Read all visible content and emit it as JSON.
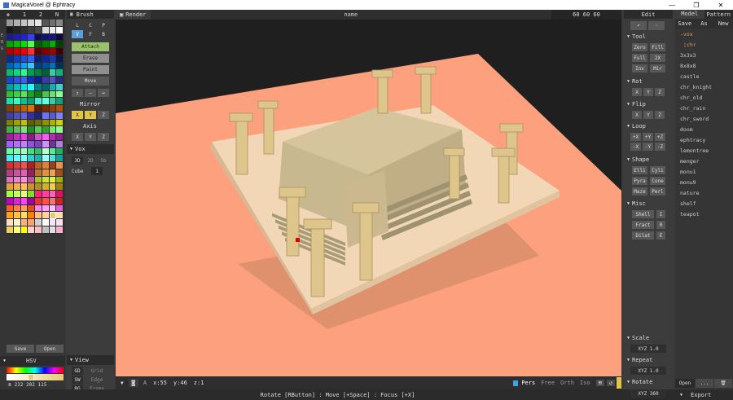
{
  "app": {
    "title": "MagicaVoxel @ Ephtracy",
    "window_buttons": [
      "—",
      "❐",
      "✕"
    ]
  },
  "palette_panel": {
    "tabs": [
      "1",
      "2",
      "N"
    ],
    "side_labels": [
      "E",
      "B",
      "G"
    ],
    "save": "Save",
    "open": "Open",
    "mode": "HSV",
    "rgb_values": "232 202 115",
    "colors": [
      "#9a9a9a",
      "#b0b0b0",
      "#c4c4c4",
      "#d6d6d6",
      "#e6e6e6",
      "#555555",
      "#707070",
      "#888888",
      "#181818",
      "#242424",
      "#303030",
      "#3d3d3d",
      "#494949",
      "#dcdcdc",
      "#ececec",
      "#ffffff",
      "#1a1a8c",
      "#1c1cb8",
      "#2020e0",
      "#3a3aff",
      "#0c0c5a",
      "#101070",
      "#141488",
      "#0a0a40",
      "#00a000",
      "#00c000",
      "#00e000",
      "#50ff50",
      "#006000",
      "#008000",
      "#00b000",
      "#004000",
      "#b00000",
      "#d00000",
      "#f00000",
      "#ff3030",
      "#600000",
      "#800000",
      "#a00000",
      "#400000",
      "#0c2c8c",
      "#1040b0",
      "#2050d0",
      "#3060f0",
      "#082070",
      "#0c2890",
      "#1838b0",
      "#0a1850",
      "#0060c0",
      "#0080e0",
      "#10a0ff",
      "#40c0ff",
      "#004080",
      "#0050a0",
      "#0070c0",
      "#003060",
      "#00c060",
      "#00e080",
      "#20ff90",
      "#00a050",
      "#008040",
      "#00603a",
      "#30d0a0",
      "#10b080",
      "#2040d0",
      "#3050e0",
      "#4060f0",
      "#1030b0",
      "#0c2090",
      "#3a3aa0",
      "#5050c0",
      "#2a2a80",
      "#00a0a0",
      "#00c0c0",
      "#00e0e0",
      "#20ffff",
      "#008080",
      "#006868",
      "#10b0b0",
      "#40d0d0",
      "#30c030",
      "#40d040",
      "#60e060",
      "#20a020",
      "#108010",
      "#50c050",
      "#70e070",
      "#90ff90",
      "#20e0b0",
      "#30ffc0",
      "#10c090",
      "#00a070",
      "#40f0d0",
      "#60ffe0",
      "#30d0a0",
      "#10a080",
      "#804000",
      "#a05000",
      "#c06000",
      "#e07000",
      "#602000",
      "#703000",
      "#904000",
      "#b05000",
      "#4040a0",
      "#5050c0",
      "#6060e0",
      "#3030a0",
      "#202080",
      "#7070ff",
      "#5858d0",
      "#8080ff",
      "#808000",
      "#a0a000",
      "#c0c000",
      "#606000",
      "#707000",
      "#909000",
      "#b0b000",
      "#d0d000",
      "#40b040",
      "#60c060",
      "#80e080",
      "#209020",
      "#50d050",
      "#30a030",
      "#70f070",
      "#90ff90",
      "#a020a0",
      "#c030c0",
      "#e040e0",
      "#802080",
      "#d050d0",
      "#f060f0",
      "#b030b0",
      "#902090",
      "#a060ff",
      "#b070ff",
      "#c080ff",
      "#9050e0",
      "#8040c0",
      "#d090ff",
      "#7030a0",
      "#b080e0",
      "#60ffa0",
      "#80ffb0",
      "#a0ffc0",
      "#40e080",
      "#30c070",
      "#c0ffd0",
      "#50f090",
      "#20b060",
      "#40f0f0",
      "#60ffff",
      "#80ffff",
      "#30d0d0",
      "#20b0b0",
      "#a0ffff",
      "#50e0e0",
      "#10a0a0",
      "#d03030",
      "#e04040",
      "#f05050",
      "#b02020",
      "#c06020",
      "#e08030",
      "#a04010",
      "#f09040",
      "#b04080",
      "#d050a0",
      "#e060b0",
      "#902060",
      "#c07030",
      "#e09040",
      "#f0a050",
      "#a05020",
      "#e070c0",
      "#f080d0",
      "#ff90e0",
      "#c050a0",
      "#b0c020",
      "#d0e030",
      "#e0f040",
      "#a0b010",
      "#e0a040",
      "#f0b050",
      "#ffc060",
      "#d09030",
      "#b09020",
      "#d0b030",
      "#f0d040",
      "#a08010",
      "#a0ff40",
      "#c0ff60",
      "#e0ff80",
      "#80e020",
      "#ff2080",
      "#ff40a0",
      "#ff60c0",
      "#e01060",
      "#c000c0",
      "#e020e0",
      "#ff40ff",
      "#a000a0",
      "#f03030",
      "#ff5050",
      "#ff7070",
      "#d02020",
      "#ff6020",
      "#ff8040",
      "#ffa060",
      "#e05010",
      "#ff80ff",
      "#ffa0ff",
      "#ffc0ff",
      "#e060e0",
      "#ffa020",
      "#ffc040",
      "#ffe060",
      "#ff8000",
      "#ffc080",
      "#ffd0a0",
      "#e8ca73",
      "#ffe0b0",
      "#ffe0c0",
      "#fff0d0",
      "#ffb080",
      "#ffa070",
      "#d0d0d0",
      "#ffffff",
      "#f8e0ff",
      "#ffe0f0",
      "#f0d060",
      "#ffff80",
      "#ffff00",
      "#ffd0d0",
      "#ffc0c0",
      "#c0c0c0",
      "#e0e0e0",
      "#ffb0d0"
    ]
  },
  "brush_panel": {
    "title": "Brush",
    "modes": [
      "L",
      "C",
      "P",
      "V",
      "F",
      "B"
    ],
    "actions": [
      "Attach",
      "Erase",
      "Paint",
      "Move"
    ],
    "undo_row": [
      "↕",
      "–",
      "↔"
    ],
    "mirror": "Mirror",
    "mirror_axes": [
      "X",
      "Y",
      "Z"
    ],
    "axis": "Axis",
    "axis_axes": [
      "X",
      "Y",
      "Z"
    ],
    "vox_section": "Vox",
    "vox_dims": [
      "3D",
      "2D",
      "Sb"
    ],
    "cube_label": "Cube",
    "cube_value": "1",
    "view_section": "View",
    "view_rows": [
      [
        "GD",
        "Grid"
      ],
      [
        "SW",
        "Edge"
      ],
      [
        "BG",
        "Frame"
      ]
    ]
  },
  "viewport": {
    "render_tab": "Render",
    "name_label": "name",
    "dims": "60 60 60",
    "coord_x": "x:55",
    "coord_y": "y:46",
    "coord_z": "z:1",
    "cam_label": "A",
    "proj_modes": [
      "Pers",
      "Free",
      "Orth",
      "Iso"
    ],
    "grid_hint": "⊞",
    "reset_icon": "↺"
  },
  "edit_panel": {
    "title": "Edit",
    "tool_section": "Tool",
    "tool_buttons": [
      "Zero",
      "Fill",
      "Full",
      "2X",
      "Inv",
      "Mir"
    ],
    "rot_section": "Rot",
    "rot_axes": [
      "X",
      "Y",
      "Z"
    ],
    "flip_section": "Flip",
    "flip_axes": [
      "X",
      "Y",
      "Z"
    ],
    "loop_section": "Loop",
    "loop_buttons": [
      "+X",
      "+Y",
      "+Z",
      "-X",
      "-Y",
      "-Z"
    ],
    "shape_section": "Shape",
    "shape_buttons": [
      "Elli",
      "Cyli",
      "Pyra",
      "Cone",
      "Maze",
      "Perl"
    ],
    "misc_section": "Misc",
    "misc_buttons": [
      "Shell",
      "I",
      "Fract",
      "R",
      "Dilat",
      "E"
    ],
    "scale_section": "Scale",
    "scale_value": "XYZ 1.0",
    "repeat_section": "Repeat",
    "repeat_value": "XYZ 1.0",
    "rotate_section": "Rotate",
    "rotate_value": "XYZ 360"
  },
  "model_panel": {
    "tabs": [
      "Model",
      "Pattern"
    ],
    "actions": [
      "Save",
      "As",
      "New"
    ],
    "folder": "vox",
    "current": "chr",
    "items": [
      "3x3x3",
      "8x8x8",
      "castle",
      "chr_knight",
      "chr_old",
      "chr_rain",
      "chr_sword",
      "doom",
      "ephtracy",
      "lemontree",
      "menger",
      "monu1",
      "monu9",
      "nature",
      "shelf",
      "teapot"
    ],
    "open": "Open",
    "more": "...",
    "export": "Export"
  },
  "status": {
    "text": "Rotate [RButton] : Move [+Space] : Focus [+X]"
  }
}
